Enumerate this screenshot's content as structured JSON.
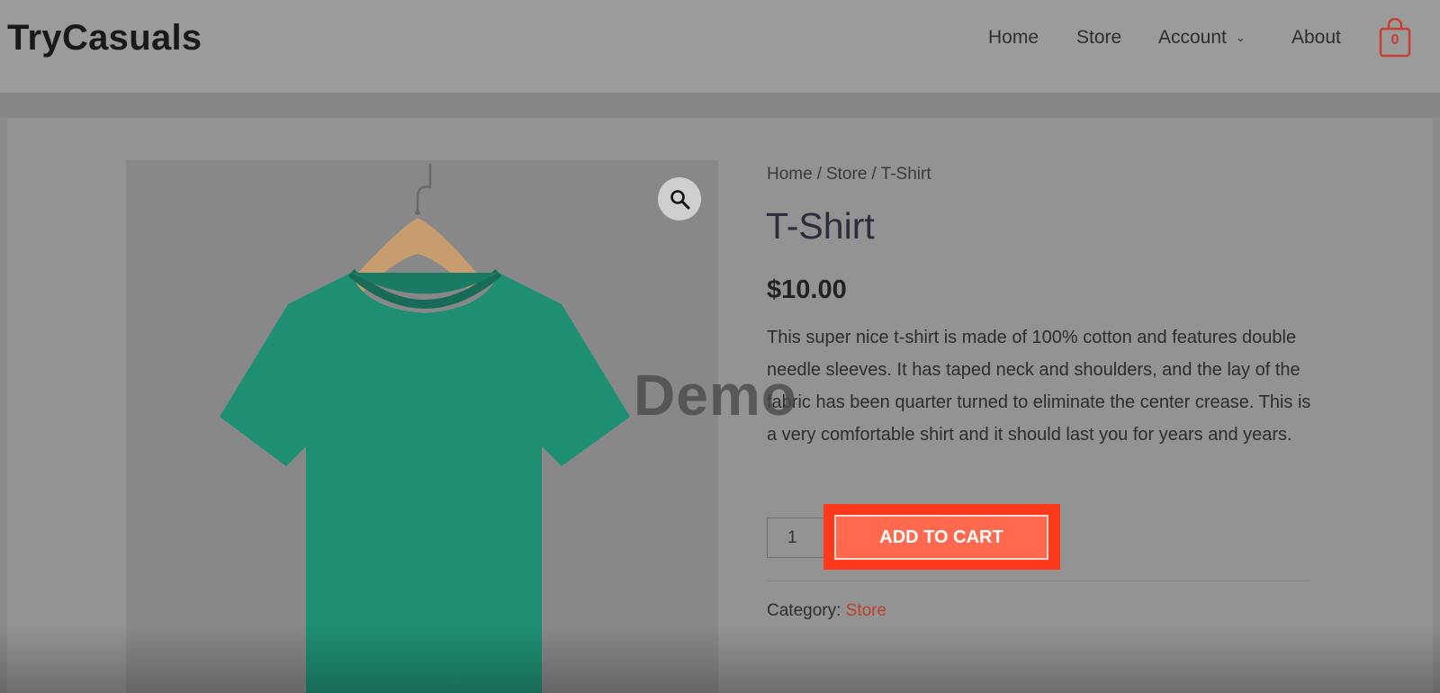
{
  "site": {
    "logo": "TryCasuals"
  },
  "nav": {
    "items": [
      {
        "label": "Home"
      },
      {
        "label": "Store"
      },
      {
        "label": "Account",
        "has_dropdown": true
      },
      {
        "label": "About"
      }
    ],
    "cart_count": "0"
  },
  "breadcrumb": [
    "Home",
    "Store",
    "T-Shirt"
  ],
  "breadcrumb_sep": "/",
  "product": {
    "title": "T-Shirt",
    "price": "$10.00",
    "description": "This super nice t-shirt is made of 100% cotton and features double needle sleeves. It has taped neck and shoulders, and the lay of the fabric has been quarter turned to eliminate the center crease. This is a very comfortable shirt and it should last you for years and years.",
    "quantity": "1",
    "add_to_cart_label": "ADD TO CART",
    "category_label": "Category:",
    "category_value": "Store",
    "image_color": "#1f8f73"
  },
  "overlay": {
    "watermark": "Demo"
  },
  "colors": {
    "accent": "#ff6a4f",
    "highlight": "#ff3a1c",
    "link": "#b8432f"
  }
}
